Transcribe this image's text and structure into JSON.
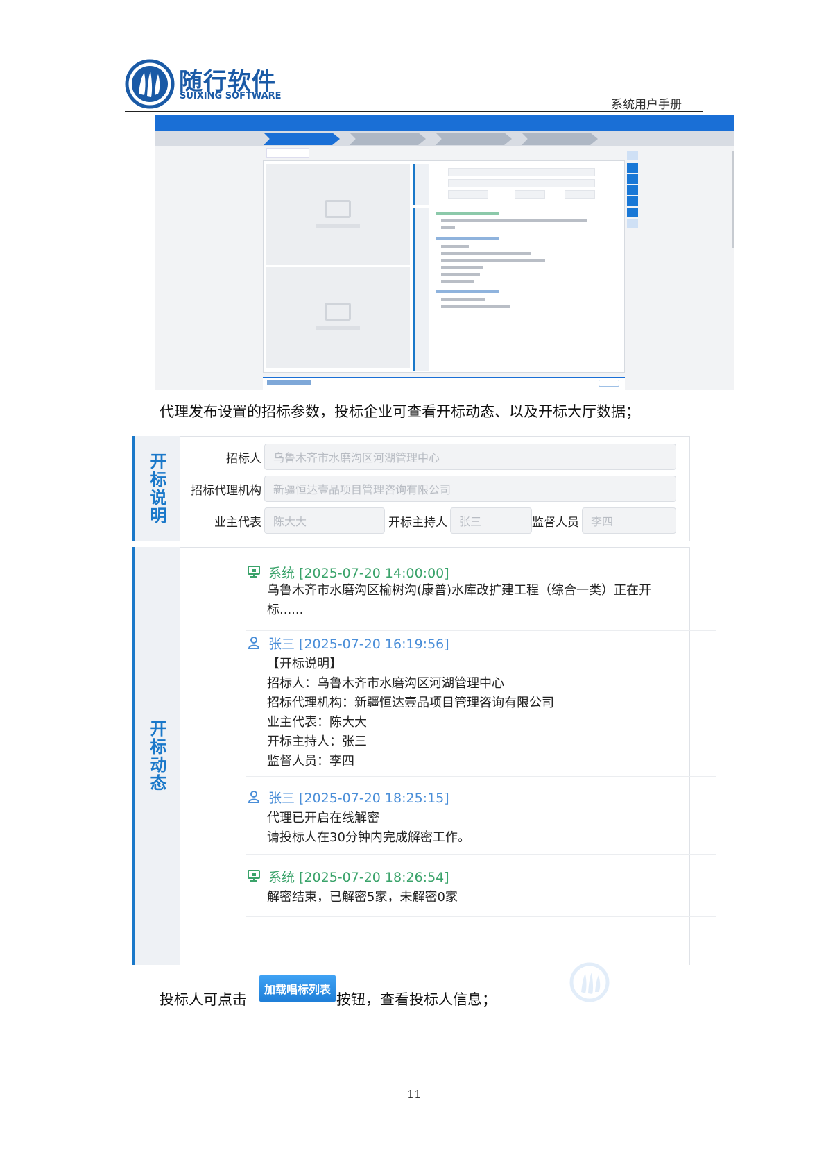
{
  "header": {
    "brand_cn": "随行软件",
    "brand_en": "SUIXING SOFTWARE",
    "manual_title": "系统用户手册"
  },
  "paragraphs": {
    "p1": "代理发布设置的招标参数，投标企业可查看开标动态、以及开标大厅数据；",
    "p2_before": "投标人可点击",
    "p2_button": "加载唱标列表",
    "p2_after": "按钮，查看投标人信息；"
  },
  "panel": {
    "section_info_label": "开标说明",
    "section_log_label": "开标动态",
    "fields": {
      "tenderer_label": "招标人",
      "tenderer_value": "乌鲁木齐市水磨沟区河湖管理中心",
      "agency_label": "招标代理机构",
      "agency_value": "新疆恒达壹品项目管理咨询有限公司",
      "owner_rep_label": "业主代表",
      "owner_rep_value": "陈大大",
      "host_label": "开标主持人",
      "host_value": "张三",
      "supervisor_label": "监督人员",
      "supervisor_value": "李四"
    },
    "log": [
      {
        "type": "system",
        "icon": "monitor-icon",
        "header": "系统 [2025-07-20 14:00:00]",
        "lines": [
          "乌鲁木齐市水磨沟区榆树沟(康普)水库改扩建工程（综合一类）正在开",
          "标......"
        ]
      },
      {
        "type": "user",
        "icon": "user-icon",
        "header": "张三 [2025-07-20 16:19:56]",
        "lines": [
          "【开标说明】",
          "招标人：乌鲁木齐市水磨沟区河湖管理中心",
          "招标代理机构：新疆恒达壹品项目管理咨询有限公司",
          "业主代表：陈大大",
          "开标主持人：张三",
          "监督人员：李四"
        ]
      },
      {
        "type": "user",
        "icon": "user-icon",
        "header": "张三 [2025-07-20 18:25:15]",
        "lines": [
          "代理已开启在线解密",
          "请投标人在30分钟内完成解密工作。"
        ]
      },
      {
        "type": "system",
        "icon": "monitor-icon",
        "header": "系统 [2025-07-20 18:26:54]",
        "lines": [
          "解密结束，已解密5家，未解密0家"
        ]
      }
    ]
  },
  "page_number": "11",
  "colors": {
    "brand_blue": "#1a5aa6",
    "accent_blue": "#1a78c9",
    "system_green": "#3aa36a",
    "user_blue": "#4a8ed8"
  }
}
